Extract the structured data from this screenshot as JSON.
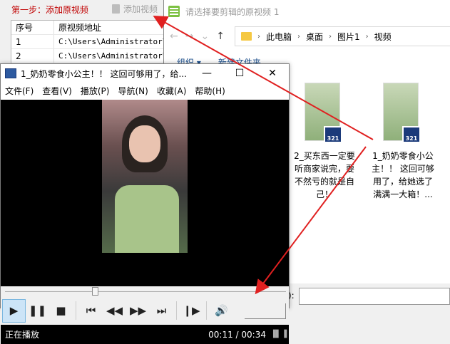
{
  "app": {
    "step_label": "第一步：添加原视频",
    "add_button": "添加视频",
    "table": {
      "headers": [
        "序号",
        "原视频地址"
      ],
      "rows": [
        [
          "1",
          "C:\\Users\\Administrator\\De"
        ],
        [
          "2",
          "C:\\Users\\Administrator\\De"
        ]
      ]
    },
    "bottom_label": "):",
    "bottom_input": ""
  },
  "explorer": {
    "title": "请选择要剪辑的原视频 1",
    "nav": {
      "back": "←",
      "forward": "→",
      "dropdown": "⌄",
      "up": "↑"
    },
    "breadcrumb": [
      "此电脑",
      "桌面",
      "图片1",
      "视频"
    ],
    "cmd": [
      "组织 ▾",
      "新建文件夹"
    ],
    "files": [
      {
        "caption": "2_买东西一定要听商家说完，要不然亏的就是自己！",
        "badge": "321"
      },
      {
        "caption": "1_奶奶零食小公主！！ 这回可够用了，给她选了满满一大箱！...",
        "badge": "321"
      }
    ]
  },
  "player": {
    "title": "1_奶奶零食小公主！！ 这回可够用了，给...",
    "window_buttons": [
      "—",
      "☐",
      "✕"
    ],
    "menu": [
      "文件(F)",
      "查看(V)",
      "播放(P)",
      "导航(N)",
      "收藏(A)",
      "帮助(H)"
    ],
    "status": "正在播放",
    "time": "00:11 / 00:34",
    "progress": 0.32
  },
  "colors": {
    "arrow": "#e02020",
    "step": "#c00000",
    "play_active": "#cce4f7"
  }
}
